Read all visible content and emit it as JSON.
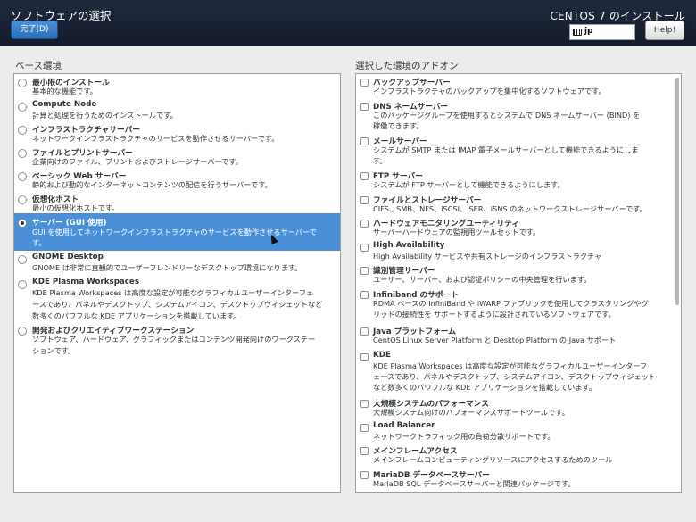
{
  "header": {
    "title": "ソフトウェアの選択",
    "done_label": "完了(D)",
    "install_title": "CENTOS 7 のインストール",
    "keyboard_layout": "jp",
    "help_label": "Help!"
  },
  "base_env": {
    "title": "ベース環境",
    "items": [
      {
        "name": "最小限のインストール",
        "desc": "基本的な機能です。",
        "selected": false
      },
      {
        "name": "Compute Node",
        "desc": "計算と処理を行うためのインストールです。",
        "selected": false
      },
      {
        "name": "インフラストラクチャサーバー",
        "desc": "ネットワークインフラストラクチャのサービスを動作させるサーバーです。",
        "selected": false
      },
      {
        "name": "ファイルとプリントサーバー",
        "desc": "企業向けのファイル、プリントおよびストレージサーバーです。",
        "selected": false
      },
      {
        "name": "ベーシック Web サーバー",
        "desc": "静的および動的なインターネットコンテンツの配信を行うサーバーです。",
        "selected": false
      },
      {
        "name": "仮想化ホスト",
        "desc": "最小の仮想化ホストです。",
        "selected": false
      },
      {
        "name": "サーバー (GUI 使用)",
        "desc_lines": [
          "GUI を使用してネットワークインフラストラクチャのサービスを動作させるサーバーで",
          "す。"
        ],
        "selected": true
      },
      {
        "name": "GNOME Desktop",
        "desc": "GNOME は非常に直観的でユーザーフレンドリーなデスクトップ環境になります。",
        "selected": false
      },
      {
        "name": "KDE Plasma Workspaces",
        "desc_lines": [
          "KDE Plasma Workspaces は高度な設定が可能なグラフィカルユーザーインターフェ",
          "ースであり、パネルやデスクトップ、システムアイコン、デスクトップウィジェットなど",
          "数多くのパワフルな KDE アプリケーションを搭載しています。"
        ],
        "selected": false
      },
      {
        "name": "開発およびクリエイティブワークステーション",
        "desc_lines": [
          "ソフトウェア、ハードウェア、グラフィックまたはコンテンツ開発向けのワークステー",
          "ションです。"
        ],
        "selected": false
      }
    ]
  },
  "addons": {
    "title": "選択した環境のアドオン",
    "items": [
      {
        "name": "バックアップサーバー",
        "desc_lines": [
          "インフラストラクチャのバックアップを集中化するソフトウェアです。"
        ]
      },
      {
        "name": "DNS ネームサーバー",
        "desc_lines": [
          "このパッケージグループを使用するとシステムで DNS ネームサーバー (BIND) を",
          "稼働できます。"
        ]
      },
      {
        "name": "メールサーバー",
        "desc_lines": [
          "システムが SMTP または IMAP 電子メールサーバーとして機能できるようにしま",
          "す。"
        ]
      },
      {
        "name": "FTP サーバー",
        "desc_lines": [
          "システムが FTP サーバーとして機能できるようにします。"
        ]
      },
      {
        "name": "ファイルとストレージサーバー",
        "desc_lines": [
          "CIFS、SMB、NFS、iSCSI、iSER、iSNS のネットワークストレージサーバーです。"
        ]
      },
      {
        "name": "ハードウェアモニタリングユーティリティ",
        "desc_lines": [
          "サーバーハードウェアの監視用ツールセットです。"
        ]
      },
      {
        "name": "High Availability",
        "desc_lines": [
          "High Availability サービスや共有ストレージのインフラストラクチャ"
        ]
      },
      {
        "name": "識別管理サーバー",
        "desc_lines": [
          "ユーザー、サーバー、および認証ポリシーの中央管理を行います。"
        ]
      },
      {
        "name": "Infiniband のサポート",
        "desc_lines": [
          "RDMA ベースの InfiniBand や iWARP ファブリックを使用してクラスタリングやグ",
          "リッドの接続性を サポートするように設計されているソフトウェアです。"
        ]
      },
      {
        "name": "Java プラットフォーム",
        "desc_lines": [
          "CentOS Linux Server Platform と Desktop Platform の Java サポート"
        ]
      },
      {
        "name": "KDE",
        "desc_lines": [
          "KDE Plasma Workspaces は高度な設定が可能なグラフィカルユーザーインターフ",
          "ェースであり、パネルやデスクトップ、システムアイコン、デスクトップウィジェット",
          "など数多くのパワフルな KDE アプリケーションを搭載しています。"
        ]
      },
      {
        "name": "大規模システムのパフォーマンス",
        "desc_lines": [
          "大規模システム向けのパフォーマンスサポートツールです。"
        ]
      },
      {
        "name": "Load Balancer",
        "desc_lines": [
          "ネットワークトラフィック用の負荷分散サポートです。"
        ]
      },
      {
        "name": "メインフレームアクセス",
        "desc_lines": [
          "メインフレームコンピューティングリソースにアクセスするためのツール"
        ]
      },
      {
        "name": "MariaDB データベースサーバー",
        "desc_lines": [
          "MariaDB SQL データベースサーバーと関連パッケージです。"
        ]
      }
    ]
  }
}
